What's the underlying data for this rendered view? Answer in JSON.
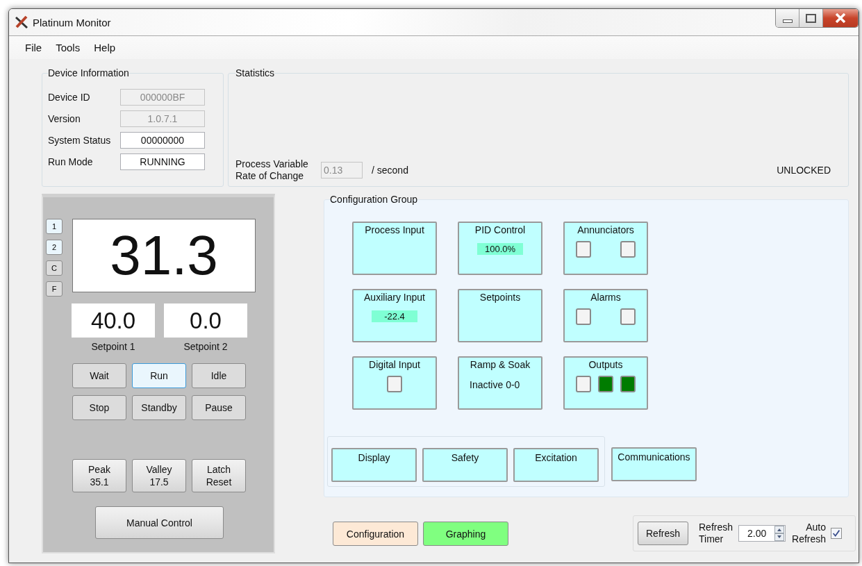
{
  "window": {
    "title": "Platinum Monitor"
  },
  "menu": [
    "File",
    "Tools",
    "Help"
  ],
  "device_information": {
    "title": "Device Information",
    "fields": [
      {
        "label": "Device ID",
        "value": "000000BF",
        "disabled": true
      },
      {
        "label": "Version",
        "value": "1.0.7.1",
        "disabled": true
      },
      {
        "label": "System Status",
        "value": "00000000",
        "disabled": false
      },
      {
        "label": "Run Mode",
        "value": "RUNNING",
        "disabled": false
      }
    ]
  },
  "statistics": {
    "title": "Statistics",
    "rate_label": [
      "Process Variable",
      "Rate of Change"
    ],
    "rate_value": "0.13",
    "rate_unit": "/ second",
    "lock_status": "UNLOCKED"
  },
  "display": {
    "keys": [
      {
        "label": "1",
        "selected": true
      },
      {
        "label": "2",
        "selected": true
      },
      {
        "label": "C",
        "selected": false
      },
      {
        "label": "F",
        "selected": false
      }
    ],
    "reading": "31.3",
    "setpoints": [
      {
        "value": "40.0",
        "label": "Setpoint 1"
      },
      {
        "value": "0.0",
        "label": "Setpoint 2"
      }
    ],
    "modes": [
      {
        "label": "Wait",
        "selected": false
      },
      {
        "label": "Run",
        "selected": true
      },
      {
        "label": "Idle",
        "selected": false
      },
      {
        "label": "Stop",
        "selected": false
      },
      {
        "label": "Standby",
        "selected": false
      },
      {
        "label": "Pause",
        "selected": false
      }
    ],
    "stats_buttons": [
      {
        "lines": [
          "Peak",
          "35.1"
        ]
      },
      {
        "lines": [
          "Valley",
          "17.5"
        ]
      },
      {
        "lines": [
          "Latch",
          "Reset"
        ]
      }
    ],
    "manual_button": "Manual Control"
  },
  "configuration_group": {
    "title": "Configuration Group",
    "tiles": [
      {
        "title": "Process Input",
        "kind": "blank"
      },
      {
        "title": "PID Control",
        "kind": "readout",
        "value": "100.0%"
      },
      {
        "title": "Annunciators",
        "kind": "lamps",
        "lamps": [
          {
            "on": false
          },
          {
            "on": false
          }
        ]
      },
      {
        "title": "Auxiliary Input",
        "kind": "readout",
        "value": "-22.4"
      },
      {
        "title": "Setpoints",
        "kind": "blank"
      },
      {
        "title": "Alarms",
        "kind": "lamps",
        "lamps": [
          {
            "on": false
          },
          {
            "on": false
          }
        ]
      },
      {
        "title": "Digital Input",
        "kind": "lamps",
        "lamps": [
          {
            "on": false
          }
        ]
      },
      {
        "title": "Ramp & Soak",
        "kind": "text",
        "value": "Inactive 0-0"
      },
      {
        "title": "Outputs",
        "kind": "lamps",
        "lamps": [
          {
            "on": false
          },
          {
            "on": true
          },
          {
            "on": true
          }
        ]
      }
    ],
    "section_buttons": [
      "Display",
      "Safety",
      "Excitation"
    ],
    "extra_button": "Communications"
  },
  "view_buttons": [
    {
      "label": "Configuration",
      "kind": "config"
    },
    {
      "label": "Graphing",
      "kind": "graph"
    }
  ],
  "refresh": {
    "button": "Refresh",
    "timer_label": [
      "Refresh",
      "Timer"
    ],
    "timer_value": "2.00",
    "auto_label": [
      "Auto",
      "Refresh"
    ],
    "auto_checked": true
  }
}
